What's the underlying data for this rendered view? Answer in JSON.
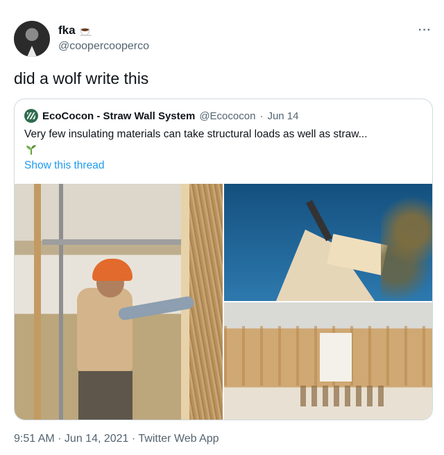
{
  "author": {
    "display_name": "fka",
    "handle": "@coopercooperco",
    "emoji": "coffee-icon"
  },
  "tweet": {
    "text": "did a wolf write this",
    "timestamp": "9:51 AM · Jun 14, 2021 · Twitter Web App"
  },
  "quoted": {
    "name": "EcoCocon - Straw Wall System",
    "handle": "@Ecococon",
    "separator": "·",
    "date": "Jun 14",
    "text": "Very few insulating materials can take structural loads as well as straw...",
    "emoji": "sprout-icon",
    "show_thread": "Show this thread"
  },
  "colors": {
    "link": "#1d9bf0",
    "secondary_text": "#536471",
    "border": "#cfd9de"
  }
}
